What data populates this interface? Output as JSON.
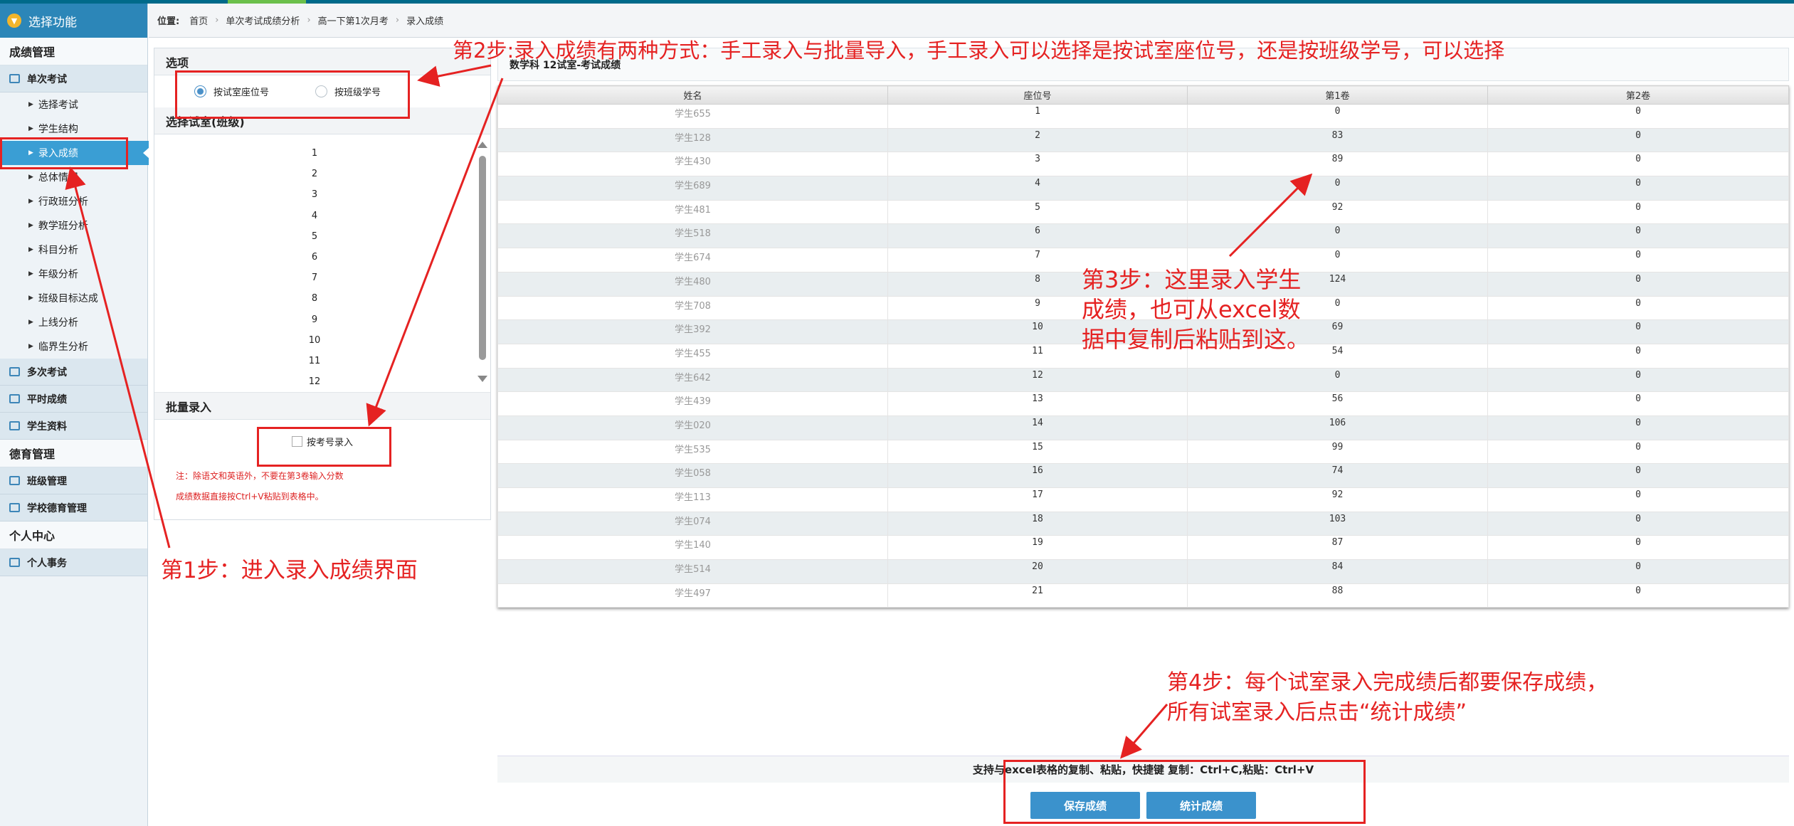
{
  "sidebar": {
    "function_title": "选择功能",
    "sections": [
      {
        "title": "成绩管理",
        "groups": [
          {
            "label": "单次考试",
            "items": [
              "选择考试",
              "学生结构",
              "录入成绩",
              "总体情况",
              "行政班分析",
              "教学班分析",
              "科目分析",
              "年级分析",
              "班级目标达成",
              "上线分析",
              "临界生分析"
            ],
            "active_index": 2
          },
          {
            "label": "多次考试",
            "items": []
          },
          {
            "label": "平时成绩",
            "items": []
          },
          {
            "label": "学生资料",
            "items": []
          }
        ]
      },
      {
        "title": "德育管理",
        "groups": [
          {
            "label": "班级管理",
            "items": []
          },
          {
            "label": "学校德育管理",
            "items": []
          }
        ]
      },
      {
        "title": "个人中心",
        "groups": [
          {
            "label": "个人事务",
            "items": []
          }
        ]
      }
    ]
  },
  "breadcrumb": {
    "label": "位置:",
    "items": [
      "首页",
      "单次考试成绩分析",
      "高一下第1次月考",
      "录入成绩"
    ]
  },
  "options": {
    "title": "选项",
    "radio_seat": "按试室座位号",
    "radio_class": "按班级学号",
    "selected": "seat"
  },
  "room_select": {
    "title": "选择试室(班级)",
    "rooms": [
      "1",
      "2",
      "3",
      "4",
      "5",
      "6",
      "7",
      "8",
      "9",
      "10",
      "11",
      "12"
    ]
  },
  "batch": {
    "title": "批量录入",
    "checkbox_label": "按考号录入",
    "note_line1": "注：除语文和英语外，不要在第3卷输入分数",
    "note_line2": "成绩数据直接按Ctrl+V粘贴到表格中。"
  },
  "grid": {
    "title": "数学科 12试室-考试成绩",
    "headers": [
      "姓名",
      "座位号",
      "第1卷",
      "第2卷"
    ],
    "rows": [
      [
        "学生655",
        "1",
        "0",
        "0"
      ],
      [
        "学生128",
        "2",
        "83",
        "0"
      ],
      [
        "学生430",
        "3",
        "89",
        "0"
      ],
      [
        "学生689",
        "4",
        "0",
        "0"
      ],
      [
        "学生481",
        "5",
        "92",
        "0"
      ],
      [
        "学生518",
        "6",
        "0",
        "0"
      ],
      [
        "学生674",
        "7",
        "0",
        "0"
      ],
      [
        "学生480",
        "8",
        "124",
        "0"
      ],
      [
        "学生708",
        "9",
        "0",
        "0"
      ],
      [
        "学生392",
        "10",
        "69",
        "0"
      ],
      [
        "学生455",
        "11",
        "54",
        "0"
      ],
      [
        "学生642",
        "12",
        "0",
        "0"
      ],
      [
        "学生439",
        "13",
        "56",
        "0"
      ],
      [
        "学生020",
        "14",
        "106",
        "0"
      ],
      [
        "学生535",
        "15",
        "99",
        "0"
      ],
      [
        "学生058",
        "16",
        "74",
        "0"
      ],
      [
        "学生113",
        "17",
        "92",
        "0"
      ],
      [
        "学生074",
        "18",
        "103",
        "0"
      ],
      [
        "学生140",
        "19",
        "87",
        "0"
      ],
      [
        "学生514",
        "20",
        "84",
        "0"
      ],
      [
        "学生497",
        "21",
        "88",
        "0"
      ]
    ]
  },
  "footer": {
    "hint": "支持与excel表格的复制、粘贴，快捷键 复制：Ctrl+C,粘贴：Ctrl+V",
    "save_button": "保存成绩",
    "stats_button": "统计成绩"
  },
  "annotations": {
    "step1": "第1步：进入录入成绩界面",
    "step2": "第2步:录入成绩有两种方式：手工录入与批量导入，手工录入可以选择是按试室座位号，还是按班级学号，可以选择",
    "step3_l1": "第3步：这里录入学生",
    "step3_l2": "成绩，也可从excel数",
    "step3_l3": "据中复制后粘贴到这。",
    "step4_l1": "第4步：每个试室录入完成绩后都要保存成绩，",
    "step4_l2": "所有试室录入后点击“统计成绩”",
    "color": "#e52222"
  },
  "colors": {
    "sidebar_active": "#3a9ed4",
    "header_bar": "#2c86b8",
    "button": "#3b92cc"
  }
}
